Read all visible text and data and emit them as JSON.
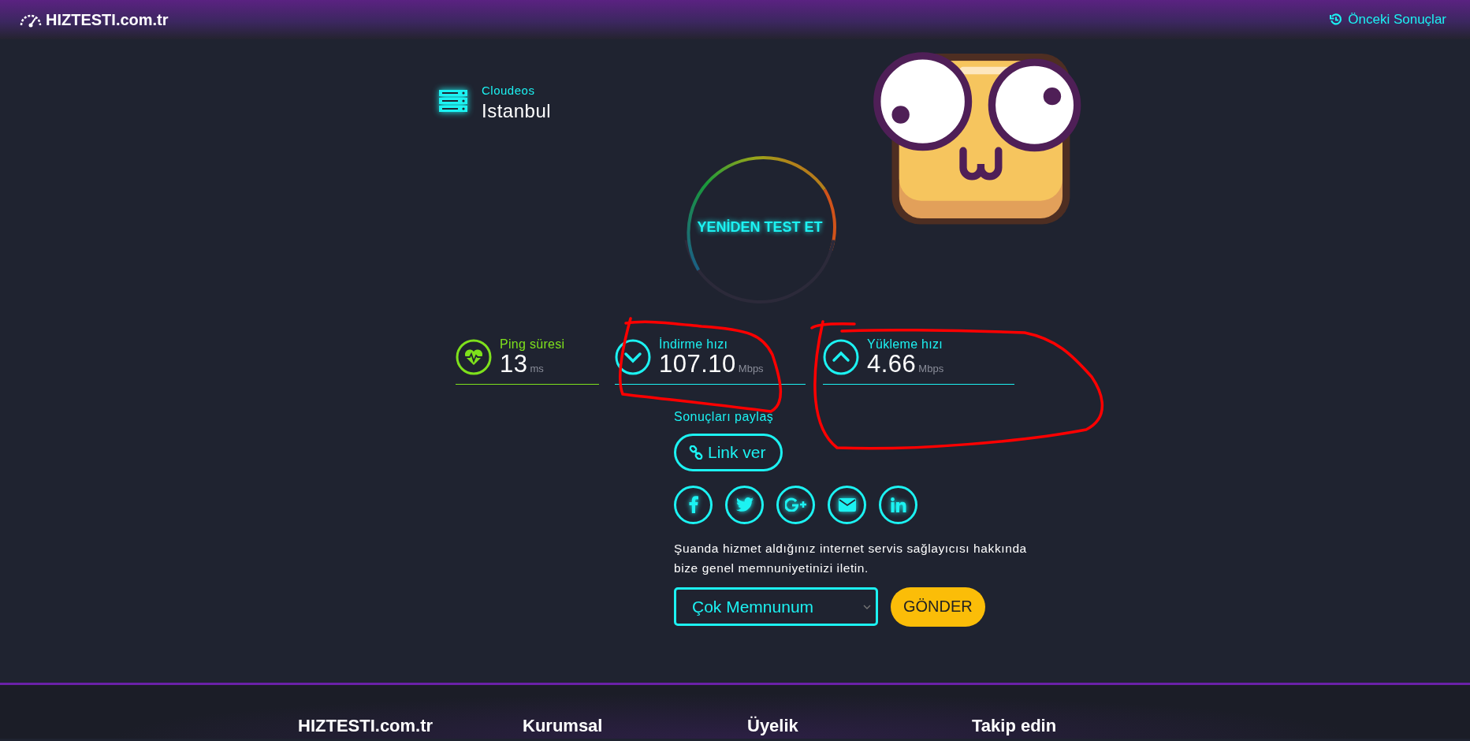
{
  "header": {
    "logo": "HIZTESTI.com.tr",
    "history_link": "Önceki Sonuçlar"
  },
  "server": {
    "provider": "Cloudeos",
    "city": "Istanbul"
  },
  "retest_button": "YENİDEN TEST ET",
  "metrics": [
    {
      "kind": "ping",
      "label": "Ping süresi",
      "value": "13",
      "unit": "ms"
    },
    {
      "kind": "download",
      "label": "İndirme hızı",
      "value": "107.10",
      "unit": "Mbps"
    },
    {
      "kind": "upload",
      "label": "Yükleme hızı",
      "value": "4.66",
      "unit": "Mbps"
    }
  ],
  "share": {
    "title": "Sonuçları paylaş",
    "link_button": "Link ver"
  },
  "feedback": {
    "prompt": "Şuanda hizmet aldığınız internet servis sağlayıcısı hakkında bize genel memnuniyetinizi iletin.",
    "selected_option": "Çok Memnunum",
    "submit_button": "GÖNDER"
  },
  "footer": {
    "columns": [
      "HIZTESTI.com.tr",
      "Kurumsal",
      "Üyelik",
      "Takip edin"
    ]
  }
}
